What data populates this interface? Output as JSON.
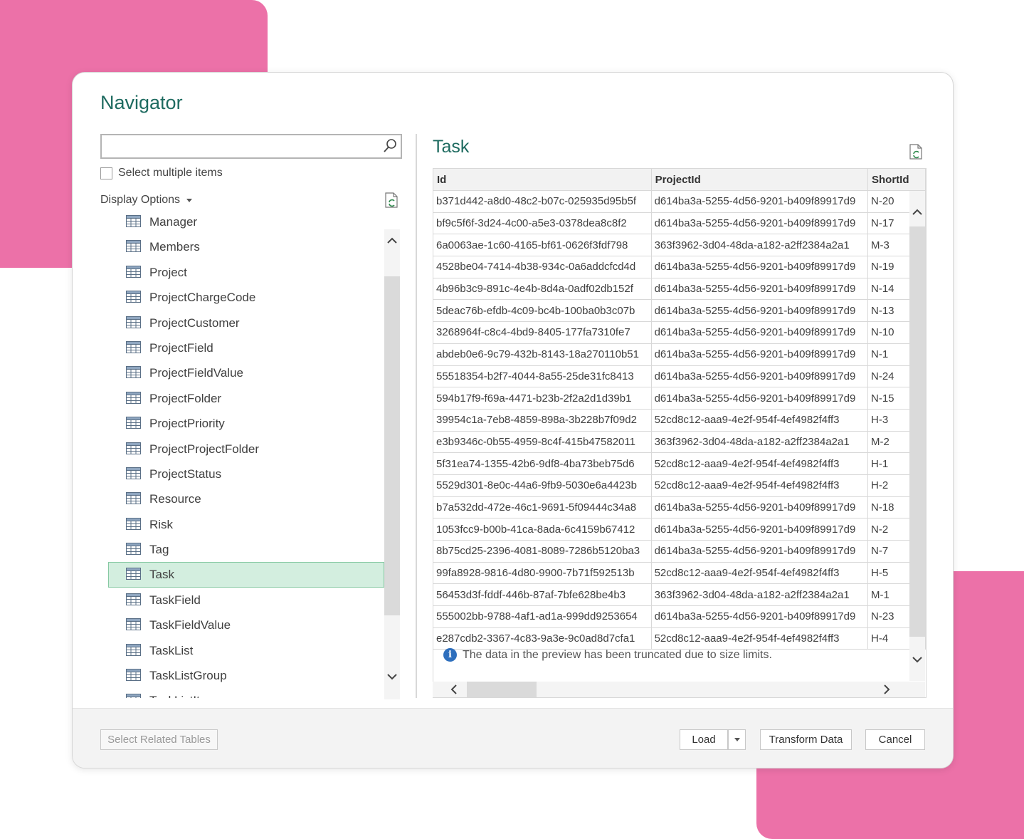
{
  "window": {
    "title": "Navigator"
  },
  "search": {
    "value": "",
    "placeholder": ""
  },
  "select_multiple": {
    "label": "Select multiple items",
    "checked": false
  },
  "display_options": {
    "label": "Display Options"
  },
  "tree": {
    "items": [
      {
        "label": "Manager",
        "selected": false
      },
      {
        "label": "Members",
        "selected": false
      },
      {
        "label": "Project",
        "selected": false
      },
      {
        "label": "ProjectChargeCode",
        "selected": false
      },
      {
        "label": "ProjectCustomer",
        "selected": false
      },
      {
        "label": "ProjectField",
        "selected": false
      },
      {
        "label": "ProjectFieldValue",
        "selected": false
      },
      {
        "label": "ProjectFolder",
        "selected": false
      },
      {
        "label": "ProjectPriority",
        "selected": false
      },
      {
        "label": "ProjectProjectFolder",
        "selected": false
      },
      {
        "label": "ProjectStatus",
        "selected": false
      },
      {
        "label": "Resource",
        "selected": false
      },
      {
        "label": "Risk",
        "selected": false
      },
      {
        "label": "Tag",
        "selected": false
      },
      {
        "label": "Task",
        "selected": true
      },
      {
        "label": "TaskField",
        "selected": false
      },
      {
        "label": "TaskFieldValue",
        "selected": false
      },
      {
        "label": "TaskList",
        "selected": false
      },
      {
        "label": "TaskListGroup",
        "selected": false
      },
      {
        "label": "TaskListItem",
        "selected": false
      }
    ]
  },
  "preview": {
    "title": "Task",
    "columns": [
      "Id",
      "ProjectId",
      "ShortId"
    ],
    "rows": [
      [
        "b371d442-a8d0-48c2-b07c-025935d95b5f",
        "d614ba3a-5255-4d56-9201-b409f89917d9",
        "N-20"
      ],
      [
        "bf9c5f6f-3d24-4c00-a5e3-0378dea8c8f2",
        "d614ba3a-5255-4d56-9201-b409f89917d9",
        "N-17"
      ],
      [
        "6a0063ae-1c60-4165-bf61-0626f3fdf798",
        "363f3962-3d04-48da-a182-a2ff2384a2a1",
        "M-3"
      ],
      [
        "4528be04-7414-4b38-934c-0a6addcfcd4d",
        "d614ba3a-5255-4d56-9201-b409f89917d9",
        "N-19"
      ],
      [
        "4b96b3c9-891c-4e4b-8d4a-0adf02db152f",
        "d614ba3a-5255-4d56-9201-b409f89917d9",
        "N-14"
      ],
      [
        "5deac76b-efdb-4c09-bc4b-100ba0b3c07b",
        "d614ba3a-5255-4d56-9201-b409f89917d9",
        "N-13"
      ],
      [
        "3268964f-c8c4-4bd9-8405-177fa7310fe7",
        "d614ba3a-5255-4d56-9201-b409f89917d9",
        "N-10"
      ],
      [
        "abdeb0e6-9c79-432b-8143-18a270110b51",
        "d614ba3a-5255-4d56-9201-b409f89917d9",
        "N-1"
      ],
      [
        "55518354-b2f7-4044-8a55-25de31fc8413",
        "d614ba3a-5255-4d56-9201-b409f89917d9",
        "N-24"
      ],
      [
        "594b17f9-f69a-4471-b23b-2f2a2d1d39b1",
        "d614ba3a-5255-4d56-9201-b409f89917d9",
        "N-15"
      ],
      [
        "39954c1a-7eb8-4859-898a-3b228b7f09d2",
        "52cd8c12-aaa9-4e2f-954f-4ef4982f4ff3",
        "H-3"
      ],
      [
        "e3b9346c-0b55-4959-8c4f-415b47582011",
        "363f3962-3d04-48da-a182-a2ff2384a2a1",
        "M-2"
      ],
      [
        "5f31ea74-1355-42b6-9df8-4ba73beb75d6",
        "52cd8c12-aaa9-4e2f-954f-4ef4982f4ff3",
        "H-1"
      ],
      [
        "5529d301-8e0c-44a6-9fb9-5030e6a4423b",
        "52cd8c12-aaa9-4e2f-954f-4ef4982f4ff3",
        "H-2"
      ],
      [
        "b7a532dd-472e-46c1-9691-5f09444c34a8",
        "d614ba3a-5255-4d56-9201-b409f89917d9",
        "N-18"
      ],
      [
        "1053fcc9-b00b-41ca-8ada-6c4159b67412",
        "d614ba3a-5255-4d56-9201-b409f89917d9",
        "N-2"
      ],
      [
        "8b75cd25-2396-4081-8089-7286b5120ba3",
        "d614ba3a-5255-4d56-9201-b409f89917d9",
        "N-7"
      ],
      [
        "99fa8928-9816-4d80-9900-7b71f592513b",
        "52cd8c12-aaa9-4e2f-954f-4ef4982f4ff3",
        "H-5"
      ],
      [
        "56453d3f-fddf-446b-87af-7bfe628be4b3",
        "363f3962-3d04-48da-a182-a2ff2384a2a1",
        "M-1"
      ],
      [
        "555002bb-9788-4af1-ad1a-999dd9253654",
        "d614ba3a-5255-4d56-9201-b409f89917d9",
        "N-23"
      ],
      [
        "e287cdb2-3367-4c83-9a3e-9c0ad8d7cfa1",
        "52cd8c12-aaa9-4e2f-954f-4ef4982f4ff3",
        "H-4"
      ]
    ],
    "info_message": "The data in the preview has been truncated due to size limits."
  },
  "footer": {
    "select_related": "Select Related Tables",
    "load": "Load",
    "transform": "Transform Data",
    "cancel": "Cancel"
  },
  "colors": {
    "accent_title": "#1e6b60",
    "selection_bg": "#d3eedf",
    "decoration": "#ec71a8",
    "info_icon": "#2e6fbd"
  },
  "icons": [
    "search-icon",
    "refresh-icon",
    "table-icon",
    "chevron-up-icon",
    "chevron-down-icon",
    "chevron-left-icon",
    "chevron-right-icon",
    "info-icon",
    "mouse-cursor-icon"
  ]
}
